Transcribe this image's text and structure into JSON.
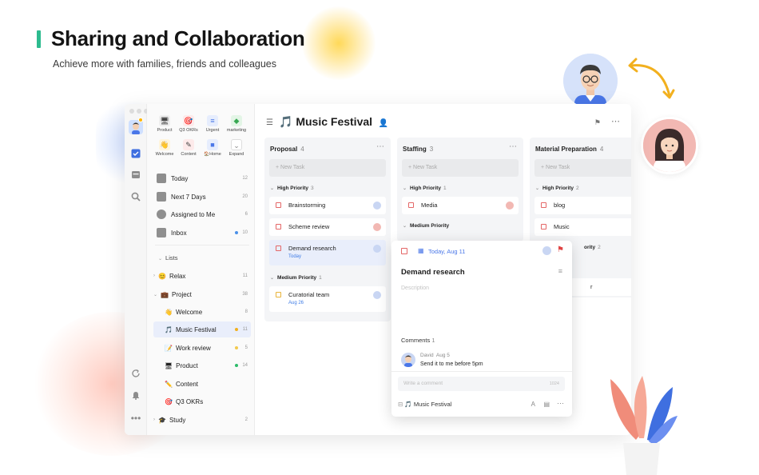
{
  "hero": {
    "title": "Sharing and Collaboration",
    "subtitle": "Achieve more with families, friends and colleagues"
  },
  "colors": {
    "accent": "#2dbb8f",
    "brand": "#4a77e8",
    "priority_high": "#e46767",
    "priority_medium": "#e9b43b"
  },
  "quick_access": [
    {
      "label": "Product",
      "icon": "monitor-icon"
    },
    {
      "label": "Q3 OKRs",
      "icon": "target-icon"
    },
    {
      "label": "Urgent",
      "icon": "list-icon"
    },
    {
      "label": "marketing",
      "icon": "tag-icon"
    },
    {
      "label": "Welcome",
      "icon": "wave-icon"
    },
    {
      "label": "Content",
      "icon": "pencil-icon"
    },
    {
      "label": "Home",
      "icon": "folder-icon",
      "prefix": "🏠"
    },
    {
      "label": "Expand",
      "icon": "chevron-down-icon"
    }
  ],
  "smart_lists": [
    {
      "label": "Today",
      "count": "12"
    },
    {
      "label": "Next 7 Days",
      "count": "20"
    },
    {
      "label": "Assigned to Me",
      "count": "6"
    },
    {
      "label": "Inbox",
      "count": "10"
    }
  ],
  "lists": {
    "header": "Lists",
    "items": [
      {
        "label": "Relax",
        "count": "11"
      },
      {
        "label": "Project",
        "count": "38"
      },
      {
        "label": "Welcome",
        "count": "8"
      },
      {
        "label": "Music Festival",
        "count": "11"
      },
      {
        "label": "Work review",
        "count": "5"
      },
      {
        "label": "Product",
        "count": "14"
      },
      {
        "label": "Content",
        "count": ""
      },
      {
        "label": "Q3 OKRs",
        "count": ""
      },
      {
        "label": "Study",
        "count": "2"
      }
    ]
  },
  "project": {
    "title": "Music Festival"
  },
  "columns": [
    {
      "name": "Proposal",
      "count": "4",
      "new_task": "+ New Task",
      "groups": [
        {
          "name": "High Priority",
          "count": "3"
        },
        {
          "name": "Medium Priority",
          "count": "1"
        }
      ],
      "tasks": [
        "Brainstorming",
        "Scheme review",
        "Demand research",
        "Curatorial team"
      ],
      "dues": [
        "Today",
        "Aug 26"
      ]
    },
    {
      "name": "Staffing",
      "count": "3",
      "new_task": "+ New Task",
      "groups": [
        {
          "name": "High Priority",
          "count": "1"
        },
        {
          "name": "Medium Priority",
          "count": ""
        }
      ],
      "tasks": [
        "Media"
      ]
    },
    {
      "name": "Material Preparation",
      "count": "4",
      "new_task": "+ New Task",
      "groups": [
        {
          "name": "High Priority",
          "count": "2"
        },
        {
          "name": "ority",
          "count": "2"
        }
      ],
      "tasks": [
        "blog",
        "Music",
        "r"
      ]
    }
  ],
  "detail": {
    "date": "Today, Aug 11",
    "title": "Demand research",
    "description_placeholder": "Description",
    "comments_label": "Comments",
    "comments_count": "1",
    "comment_author": "David",
    "comment_date": "Aug 5",
    "comment_text": "Send it to me before 5pm",
    "comment_placeholder": "Write a comment",
    "comment_limit": "1024",
    "list_name": "Music Festival"
  }
}
